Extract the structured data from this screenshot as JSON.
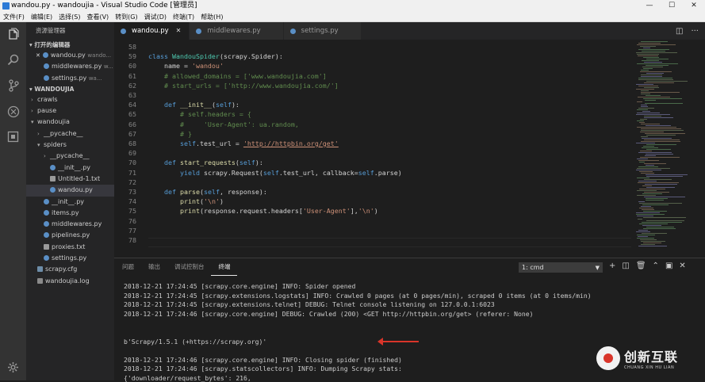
{
  "window": {
    "title": "wandou.py - wandoujia - Visual Studio Code [管理员]"
  },
  "menu": [
    "文件(F)",
    "编辑(E)",
    "选择(S)",
    "查看(V)",
    "转到(G)",
    "调试(D)",
    "终端(T)",
    "帮助(H)"
  ],
  "activity": [
    "files-icon",
    "search-icon",
    "source-control-icon",
    "debug-icon",
    "extensions-icon",
    "settings-gear-icon"
  ],
  "sidebar": {
    "header": "资源管理器",
    "open_editors_title": "打开的编辑器",
    "open_editors": [
      {
        "name": "wandou.py",
        "hint": "wando..."
      },
      {
        "name": "middlewares.py",
        "hint": "w..."
      },
      {
        "name": "settings.py",
        "hint": "wa..."
      }
    ],
    "project_title": "WANDOUJIA",
    "tree": [
      {
        "name": "crawls",
        "type": "folder",
        "depth": 0,
        "open": false
      },
      {
        "name": "pause",
        "type": "folder",
        "depth": 0,
        "open": false
      },
      {
        "name": "wandoujia",
        "type": "folder",
        "depth": 0,
        "open": true
      },
      {
        "name": "__pycache__",
        "type": "folder",
        "depth": 1,
        "open": false
      },
      {
        "name": "spiders",
        "type": "folder",
        "depth": 1,
        "open": true
      },
      {
        "name": "__pycache__",
        "type": "folder",
        "depth": 2,
        "open": false
      },
      {
        "name": "__init__.py",
        "type": "py",
        "depth": 2
      },
      {
        "name": "Untitled-1.txt",
        "type": "txt",
        "depth": 2
      },
      {
        "name": "wandou.py",
        "type": "py",
        "depth": 2,
        "selected": true
      },
      {
        "name": "__init__.py",
        "type": "py",
        "depth": 1
      },
      {
        "name": "items.py",
        "type": "py",
        "depth": 1
      },
      {
        "name": "middlewares.py",
        "type": "py",
        "depth": 1
      },
      {
        "name": "pipelines.py",
        "type": "py",
        "depth": 1
      },
      {
        "name": "proxies.txt",
        "type": "txt",
        "depth": 1
      },
      {
        "name": "settings.py",
        "type": "py",
        "depth": 1
      },
      {
        "name": "scrapy.cfg",
        "type": "cfg",
        "depth": 0
      },
      {
        "name": "wandoujia.log",
        "type": "log",
        "depth": 0
      }
    ]
  },
  "tabs": [
    {
      "name": "wandou.py",
      "active": true
    },
    {
      "name": "middlewares.py",
      "active": false
    },
    {
      "name": "settings.py",
      "active": false
    }
  ],
  "editor": {
    "lines": [
      {
        "n": "58",
        "html": ""
      },
      {
        "n": "59",
        "html": "<span class=\"k\">class</span> <span class=\"n\">WandouSpider</span>(scrapy.Spider):"
      },
      {
        "n": "60",
        "html": "    name = <span class=\"s\">'wandou'</span>"
      },
      {
        "n": "61",
        "html": "    <span class=\"c\"># allowed_domains = ['www.wandoujia.com']</span>"
      },
      {
        "n": "62",
        "html": "    <span class=\"c\"># start_urls = ['http://www.wandoujia.com/']</span>"
      },
      {
        "n": "63",
        "html": ""
      },
      {
        "n": "64",
        "html": "    <span class=\"k\">def</span> <span class=\"f\">__init__</span>(<span class=\"sf\">self</span>):"
      },
      {
        "n": "65",
        "html": "        <span class=\"c\"># self.headers = {</span>"
      },
      {
        "n": "66",
        "html": "        <span class=\"c\">#     'User-Agent': ua.random,</span>"
      },
      {
        "n": "67",
        "html": "        <span class=\"c\"># }</span>"
      },
      {
        "n": "68",
        "html": "        <span class=\"sf\">self</span>.test_url = <span class=\"u\">'http://httpbin.org/get'</span>"
      },
      {
        "n": "69",
        "html": ""
      },
      {
        "n": "70",
        "html": "    <span class=\"k\">def</span> <span class=\"f\">start_requests</span>(<span class=\"sf\">self</span>):"
      },
      {
        "n": "71",
        "html": "        <span class=\"k\">yield</span> scrapy.Request(<span class=\"sf\">self</span>.test_url, callback=<span class=\"sf\">self</span>.parse)"
      },
      {
        "n": "72",
        "html": ""
      },
      {
        "n": "73",
        "html": "    <span class=\"k\">def</span> <span class=\"f\">parse</span>(<span class=\"sf\">self</span>, response):"
      },
      {
        "n": "74",
        "html": "        <span class=\"f\">print</span>(<span class=\"s\">'\\n'</span>)"
      },
      {
        "n": "75",
        "html": "        <span class=\"f\">print</span>(response.request.headers[<span class=\"s\">'User-Agent'</span>],<span class=\"s\">'\\n'</span>)"
      },
      {
        "n": "76",
        "html": ""
      },
      {
        "n": "77",
        "html": ""
      },
      {
        "n": "78",
        "html": ""
      }
    ]
  },
  "panel": {
    "tabs": [
      "问题",
      "输出",
      "调试控制台",
      "终端"
    ],
    "active_tab": "终端",
    "terminal_select": "1: cmd",
    "lines": [
      "2018-12-21 17:24:45 [scrapy.core.engine] INFO: Spider opened",
      "2018-12-21 17:24:45 [scrapy.extensions.logstats] INFO: Crawled 0 pages (at 0 pages/min), scraped 0 items (at 0 items/min)",
      "2018-12-21 17:24:45 [scrapy.extensions.telnet] DEBUG: Telnet console listening on 127.0.0.1:6023",
      "2018-12-21 17:24:46 [scrapy.core.engine] DEBUG: Crawled (200) <GET http://httpbin.org/get> (referer: None)",
      "",
      "",
      "b'Scrapy/1.5.1 (+https://scrapy.org)'",
      "",
      "2018-12-21 17:24:46 [scrapy.core.engine] INFO: Closing spider (finished)",
      "2018-12-21 17:24:46 [scrapy.statscollectors] INFO: Dumping Scrapy stats:",
      "{'downloader/request_bytes': 216,"
    ]
  },
  "watermark": {
    "cn": "创新互联",
    "en": "CHUANG XIN HU LIAN"
  }
}
